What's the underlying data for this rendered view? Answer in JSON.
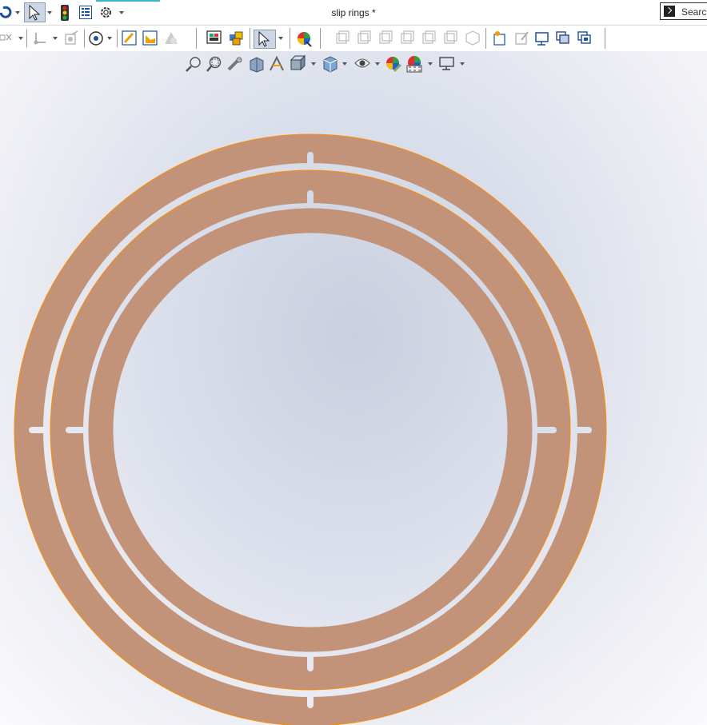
{
  "window": {
    "title": "slip rings *"
  },
  "search": {
    "label": "Search"
  },
  "icons": {
    "title_bar": [
      "undo-icon",
      "select-arrow-icon",
      "traffic-light-icon",
      "feature-manager-icon",
      "options-gear-icon"
    ],
    "command_bar": [
      "sketch-icon",
      "datum-icon",
      "reference-icon",
      "revolve-icon",
      "smart-dimension-icon",
      "sketch-chart-icon",
      "cone-icon",
      "layout-icon",
      "assembly-icon",
      "select-arrow-icon",
      "appearance-icon",
      "view-standard-icons",
      "drawing-icons"
    ],
    "heads_up": [
      "zoom-to-fit-icon",
      "zoom-area-icon",
      "previous-view-icon",
      "section-view-icon",
      "dynamic-annotation-icon",
      "view-orientation-icon",
      "display-style-icon",
      "hide-show-icon",
      "edit-appearance-icon",
      "apply-scene-icon",
      "view-settings-icon"
    ]
  },
  "colors": {
    "ring_fill": "#c29378",
    "ring_edge": "#ff8c00",
    "accent": "#3cb4c8"
  }
}
